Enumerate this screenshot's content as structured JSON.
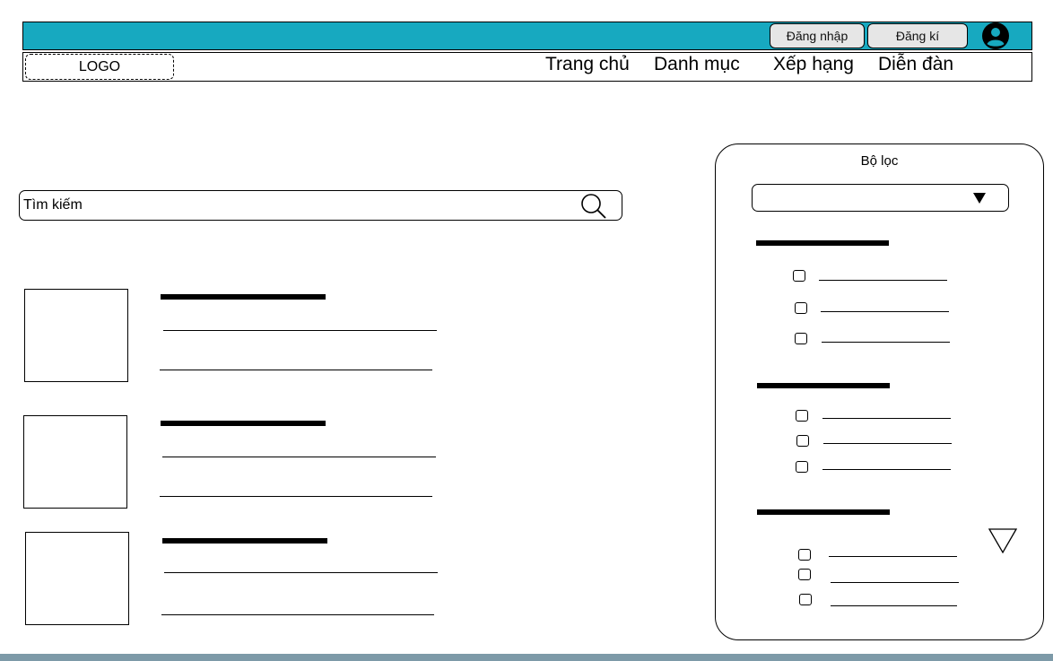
{
  "header": {
    "login_label": "Đăng nhập",
    "register_label": "Đăng kí",
    "bar_color": "#17a9c0",
    "avatar_icon": "user-circle-icon"
  },
  "brand": {
    "logo_text": "LOGO"
  },
  "nav": {
    "items": [
      {
        "label": "Trang chủ"
      },
      {
        "label": "Danh mục"
      },
      {
        "label": "Xếp hạng"
      },
      {
        "label": "Diễn đàn"
      }
    ]
  },
  "search": {
    "placeholder": "Tìm kiếm",
    "value": "",
    "icon": "search-icon"
  },
  "results": {
    "item_count": 3
  },
  "filter": {
    "title": "Bộ lọc",
    "dropdown_value": "",
    "groups": [
      {
        "options": 3
      },
      {
        "options": 3
      },
      {
        "options": 3
      }
    ],
    "expand_icon": "triangle-down-icon"
  }
}
